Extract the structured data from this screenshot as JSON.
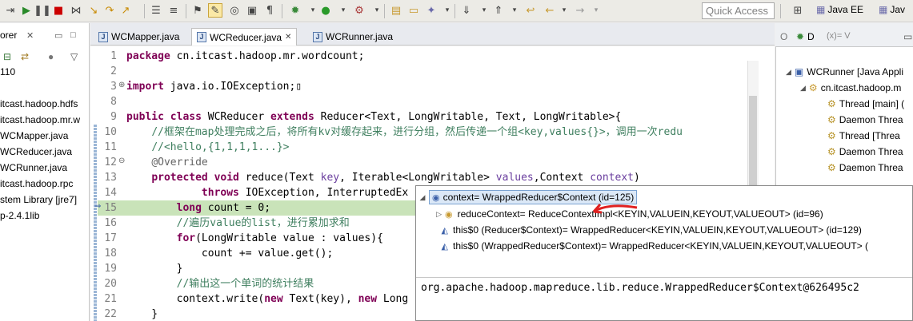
{
  "toolbar": {
    "quick_access_placeholder": "Quick Access",
    "perspectives": [
      "Java EE",
      "Jav"
    ]
  },
  "left_panel": {
    "tab_label": "orer",
    "tree": [
      "110",
      "itcast.hadoop.hdfs",
      "itcast.hadoop.mr.w",
      "WCMapper.java",
      "WCReducer.java",
      "WCRunner.java",
      "itcast.hadoop.rpc",
      "stem Library [jre7]",
      "p-2.4.1lib"
    ]
  },
  "editor": {
    "tabs": [
      "WCMapper.java",
      "WCReducer.java",
      "WCRunner.java"
    ],
    "active_tab": 1,
    "current_line": 15
  },
  "right_panel": {
    "tabs": [
      "O",
      "D",
      "(x)= V"
    ],
    "tree": [
      "WCRunner [Java Appli",
      "cn.itcast.hadoop.m",
      "Thread [main] (",
      "Daemon Threa",
      "Thread [Threa",
      "Daemon Threa",
      "Daemon Threa"
    ]
  },
  "popup": {
    "rows": [
      {
        "label": "context= WrappedReducer$Context  (id=125)"
      },
      {
        "label": "reduceContext= ReduceContextImpl<KEYIN,VALUEIN,KEYOUT,VALUEOUT>  (id=96)"
      },
      {
        "label": "this$0 (Reducer$Context)= WrappedReducer<KEYIN,VALUEIN,KEYOUT,VALUEOUT>  (id=129)"
      },
      {
        "label": "this$0 (WrappedReducer$Context)= WrappedReducer<KEYIN,VALUEIN,KEYOUT,VALUEOUT>  ("
      }
    ],
    "detail": "org.apache.hadoop.mapreduce.lib.reduce.WrappedReducer$Context@626495c2"
  },
  "colors": {
    "keyword": "#7f0055",
    "comment": "#3f7f5f",
    "current_line": "#c9e3b9"
  }
}
